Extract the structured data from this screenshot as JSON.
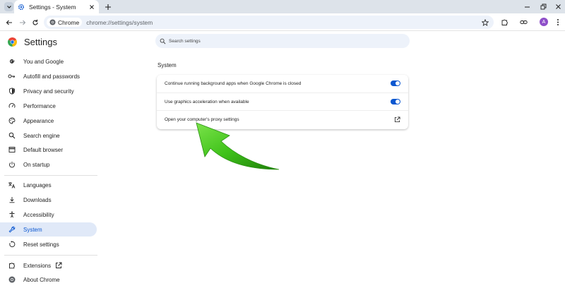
{
  "browser": {
    "tab_title": "Settings - System",
    "address_chip": "Chrome",
    "url": "chrome://settings/system",
    "avatar_letter": "A"
  },
  "sidebar": {
    "title": "Settings",
    "items": [
      {
        "label": "You and Google",
        "icon": "google-g-icon"
      },
      {
        "label": "Autofill and passwords",
        "icon": "key-icon"
      },
      {
        "label": "Privacy and security",
        "icon": "shield-icon"
      },
      {
        "label": "Performance",
        "icon": "speedometer-icon"
      },
      {
        "label": "Appearance",
        "icon": "palette-icon"
      },
      {
        "label": "Search engine",
        "icon": "search-icon"
      },
      {
        "label": "Default browser",
        "icon": "browser-window-icon"
      },
      {
        "label": "On startup",
        "icon": "power-icon"
      },
      {
        "label": "Languages",
        "icon": "translate-icon"
      },
      {
        "label": "Downloads",
        "icon": "download-icon"
      },
      {
        "label": "Accessibility",
        "icon": "accessibility-icon"
      },
      {
        "label": "System",
        "icon": "wrench-icon",
        "active": true
      },
      {
        "label": "Reset settings",
        "icon": "reset-icon"
      },
      {
        "label": "Extensions",
        "icon": "puzzle-icon"
      },
      {
        "label": "About Chrome",
        "icon": "chrome-logo-icon"
      }
    ]
  },
  "main": {
    "search_placeholder": "Search settings",
    "section_title": "System",
    "rows": [
      {
        "label": "Continue running background apps when Google Chrome is closed",
        "control": "toggle",
        "on": true
      },
      {
        "label": "Use graphics acceleration when available",
        "control": "toggle",
        "on": true
      },
      {
        "label": "Open your computer's proxy settings",
        "control": "external-link"
      }
    ]
  },
  "colors": {
    "accent": "#0b57d0",
    "active_nav_bg": "#e0e9f8",
    "tabstrip_bg": "#dde3ea",
    "arrow_green": "#3fc21a"
  }
}
